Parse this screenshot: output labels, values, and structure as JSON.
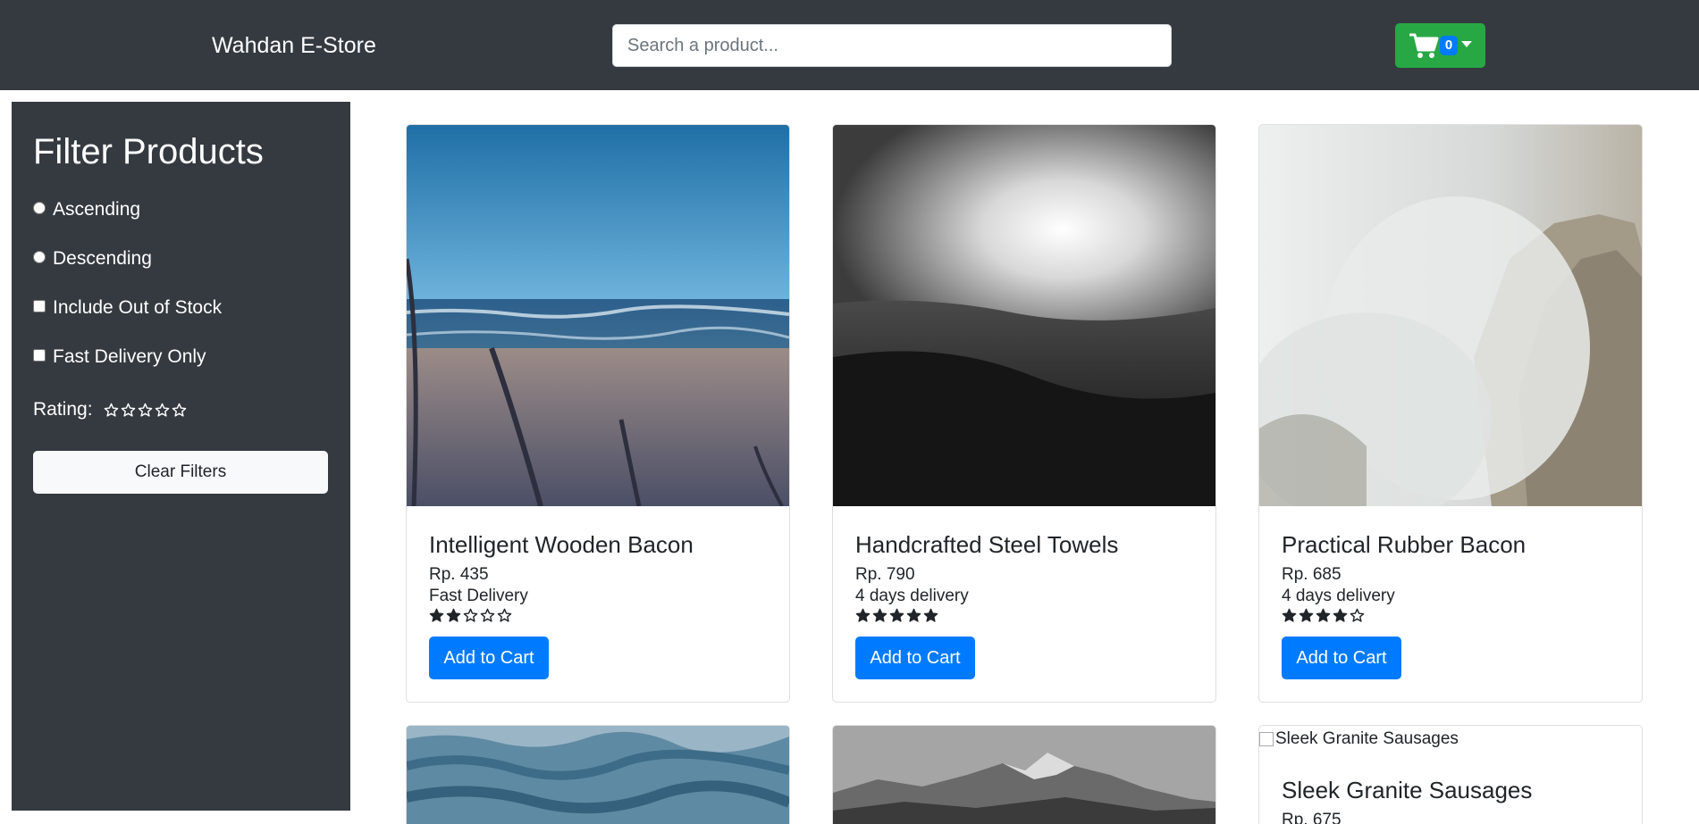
{
  "header": {
    "brand": "Wahdan E-Store",
    "search_placeholder": "Search a product...",
    "cart_count": "0",
    "cart_icon": "shopping-cart-icon"
  },
  "sidebar": {
    "title": "Filter Products",
    "options": [
      {
        "label": "Ascending",
        "type": "radio"
      },
      {
        "label": "Descending",
        "type": "radio"
      },
      {
        "label": "Include Out of Stock",
        "type": "checkbox"
      },
      {
        "label": "Fast Delivery Only",
        "type": "checkbox"
      }
    ],
    "rating_label": "Rating:",
    "rating_value": 0,
    "clear_label": "Clear Filters"
  },
  "products": [
    {
      "name": "Intelligent Wooden Bacon",
      "price": "Rp. 435",
      "delivery": "Fast Delivery",
      "rating": 2,
      "button": "Add to Cart",
      "image": "beach-photo"
    },
    {
      "name": "Handcrafted Steel Towels",
      "price": "Rp. 790",
      "delivery": "4 days delivery",
      "rating": 5,
      "button": "Add to Cart",
      "image": "sunlit-hills-photo"
    },
    {
      "name": "Practical Rubber Bacon",
      "price": "Rp. 685",
      "delivery": "4 days delivery",
      "rating": 4,
      "button": "Add to Cart",
      "image": "misty-cliff-photo"
    },
    {
      "image": "ocean-water-photo"
    },
    {
      "image": "mountain-range-photo"
    },
    {
      "name": "Sleek Granite Sausages",
      "price": "Rp. 675",
      "image_alt": "Sleek Granite Sausages"
    }
  ],
  "colors": {
    "navbar": "#343a40",
    "cart_button": "#28a745",
    "primary": "#007bff",
    "light": "#f8f9fa"
  }
}
